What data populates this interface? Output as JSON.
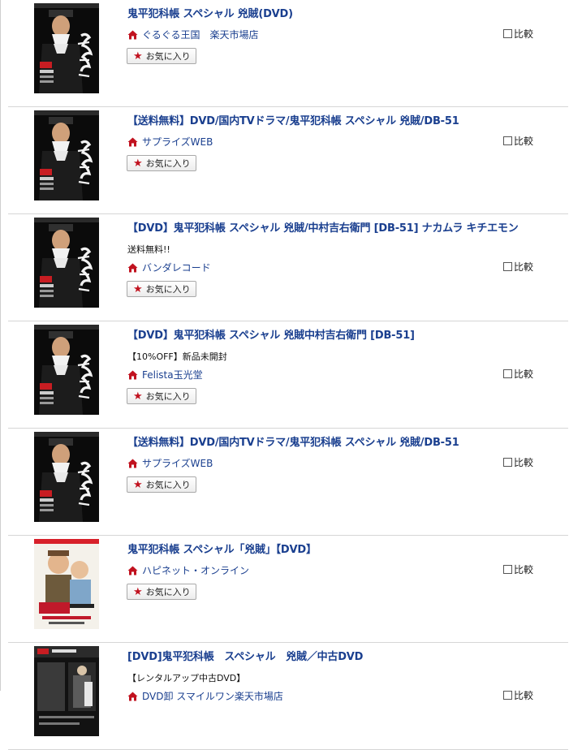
{
  "fav_label": "お気に入り",
  "compare_label": "比較",
  "items": [
    {
      "title": "鬼平犯科帳 スペシャル 兇賊(DVD)",
      "note": "",
      "shop": "ぐるぐる王国　楽天市場店",
      "fav": true,
      "cover": "onihei"
    },
    {
      "title": "【送料無料】DVD/国内TVドラマ/鬼平犯科帳 スペシャル 兇賊/DB-51",
      "note": "",
      "shop": "サプライズWEB",
      "fav": true,
      "cover": "onihei"
    },
    {
      "title": "【DVD】鬼平犯科帳 スペシャル 兇賊/中村吉右衛門 [DB-51] ナカムラ キチエモン",
      "note": "送料無料!!",
      "shop": "バンダレコード",
      "fav": true,
      "cover": "onihei"
    },
    {
      "title": "【DVD】鬼平犯科帳 スペシャル 兇賊中村吉右衛門 [DB-51]",
      "note": "【10%OFF】新品未開封",
      "shop": "Felista玉光堂",
      "fav": true,
      "cover": "onihei"
    },
    {
      "title": "【送料無料】DVD/国内TVドラマ/鬼平犯科帳 スペシャル 兇賊/DB-51",
      "note": "",
      "shop": "サプライズWEB",
      "fav": true,
      "cover": "onihei"
    },
    {
      "title": "鬼平犯科帳 スペシャル「兇賊」【DVD】",
      "note": "",
      "shop": "ハピネット・オンライン",
      "fav": true,
      "cover": "tora"
    },
    {
      "title": "[DVD]鬼平犯科帳　スペシャル　兇賊／中古DVD",
      "note": "【レンタルアップ中古DVD】",
      "shop": "DVD卸 スマイルワン楽天市場店",
      "fav": false,
      "cover": "rental"
    }
  ]
}
